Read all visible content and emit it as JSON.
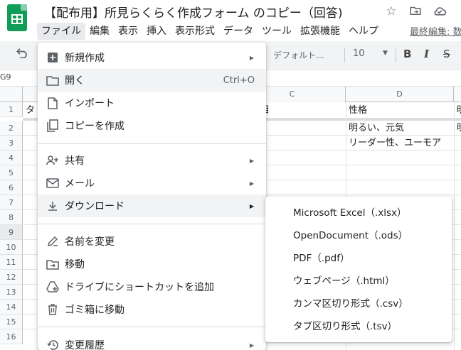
{
  "document": {
    "title": "【配布用】所見らくらく作成フォーム のコピー（回答)",
    "last_edit": "最終編集: 数"
  },
  "menubar": [
    "ファイル",
    "編集",
    "表示",
    "挿入",
    "表示形式",
    "データ",
    "ツール",
    "拡張機能",
    "ヘルプ"
  ],
  "toolbar": {
    "font": "デフォルト...",
    "font_size": "10",
    "bold": "B",
    "italic": "I",
    "strike": "S"
  },
  "formula_bar": {
    "name_box": "G9"
  },
  "sheet": {
    "columns": [
      "C",
      "D"
    ],
    "rows": [
      "1",
      "2",
      "3",
      "4",
      "5",
      "6",
      "7",
      "8",
      "9",
      "10",
      "11",
      "12",
      "13",
      "14",
      "15",
      "16"
    ],
    "cells": {
      "a1_fragment": "タ",
      "c1_fragment": "目",
      "d1": "性格",
      "d2": "明るい、元気",
      "d3": "リーダー性、ユーモア",
      "e1_fragment": "明",
      "e2_fragment": "明"
    }
  },
  "file_menu": {
    "items": [
      {
        "label": "新規作成",
        "icon": "new-sheet-icon",
        "arrow": true
      },
      {
        "label": "開く",
        "icon": "folder-icon",
        "shortcut": "Ctrl+O"
      },
      {
        "label": "インポート",
        "icon": "file-icon"
      },
      {
        "label": "コピーを作成",
        "icon": "copy-icon"
      },
      {
        "label": "共有",
        "icon": "person-add-icon",
        "arrow": true
      },
      {
        "label": "メール",
        "icon": "mail-icon",
        "arrow": true
      },
      {
        "label": "ダウンロード",
        "icon": "download-icon",
        "arrow": true
      },
      {
        "label": "名前を変更",
        "icon": "rename-icon"
      },
      {
        "label": "移動",
        "icon": "move-folder-icon"
      },
      {
        "label": "ドライブにショートカットを追加",
        "icon": "drive-shortcut-icon"
      },
      {
        "label": "ゴミ箱に移動",
        "icon": "trash-icon"
      },
      {
        "label": "変更履歴",
        "icon": "history-icon",
        "arrow": true
      }
    ]
  },
  "download_submenu": {
    "items": [
      "Microsoft Excel（.xlsx）",
      "OpenDocument（.ods）",
      "PDF（.pdf）",
      "ウェブページ（.html）",
      "カンマ区切り形式（.csv）",
      "タブ区切り形式（.tsv）"
    ]
  },
  "colors": {
    "brand": "#0f9d58",
    "hover": "#f1f3f4"
  }
}
